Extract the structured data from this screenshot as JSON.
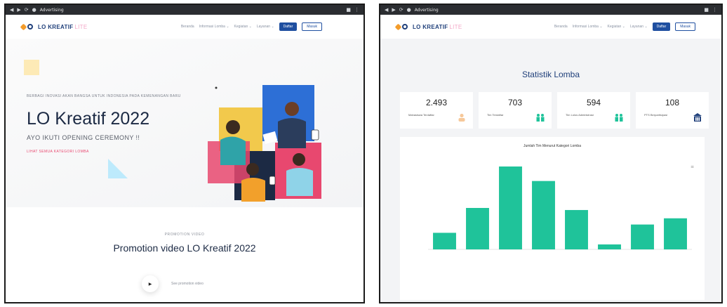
{
  "left": {
    "browser": {
      "tab_title": "Advertising"
    },
    "navbar": {
      "brand": "LO KREATIF",
      "brand_suffix": "LITE",
      "items": [
        "Beranda",
        "Informasi Lomba ⌄",
        "Kegiatan ⌄",
        "Layanan ⌄"
      ],
      "daftar": "Daftar",
      "masuk": "Masuk"
    },
    "hero": {
      "kicker": "BERBAGI INOVASI AKAN BANGSA UNTUK INDONESIA PADA KEMENANGAN BARU",
      "title": "LO Kreatif 2022",
      "subtitle": "AYO IKUTI OPENING CEREMONY !!",
      "link": "LIHAT SEMUA KATEGORI LOMBA"
    },
    "promo": {
      "kicker": "PROMOTION VIDEO",
      "title": "Promotion video LO Kreatif 2022",
      "play_label": "See promotion video"
    }
  },
  "right": {
    "browser": {
      "tab_title": "Advertising"
    },
    "navbar": {
      "brand": "LO KREATIF",
      "brand_suffix": "LITE",
      "items": [
        "Beranda",
        "Informasi Lomba ⌄",
        "Kegiatan ⌄",
        "Layanan ⌄"
      ],
      "daftar": "Daftar",
      "masuk": "Masuk"
    },
    "section_title": "Statistik Lomba",
    "stats": [
      {
        "value": "2.493",
        "label": "Mahasiswa Terdaftar",
        "icon": "user-icon",
        "color": "#f6c89a"
      },
      {
        "value": "703",
        "label": "Tim Terdaftar",
        "icon": "team-icon",
        "color": "#1fc39a"
      },
      {
        "value": "594",
        "label": "Tim Lolos Administrasi",
        "icon": "team-icon",
        "color": "#1fc39a"
      },
      {
        "value": "108",
        "label": "PTS Berpartisipasi",
        "icon": "building-icon",
        "color": "#1f3f7a"
      }
    ],
    "chart_data": {
      "type": "bar",
      "title": "Jumlah Tim Menurut Kategori Lomba",
      "categories": [
        "",
        "",
        "",
        "",
        "",
        "",
        "",
        ""
      ],
      "values": [
        40,
        100,
        200,
        165,
        95,
        12,
        60,
        75
      ],
      "data_labels": [
        "",
        "",
        "",
        "",
        "",
        "",
        "",
        ""
      ],
      "ylim": [
        0,
        200
      ],
      "yticks": [
        "",
        "",
        "",
        "",
        ""
      ],
      "color": "#1fc39a",
      "grid": false
    }
  }
}
